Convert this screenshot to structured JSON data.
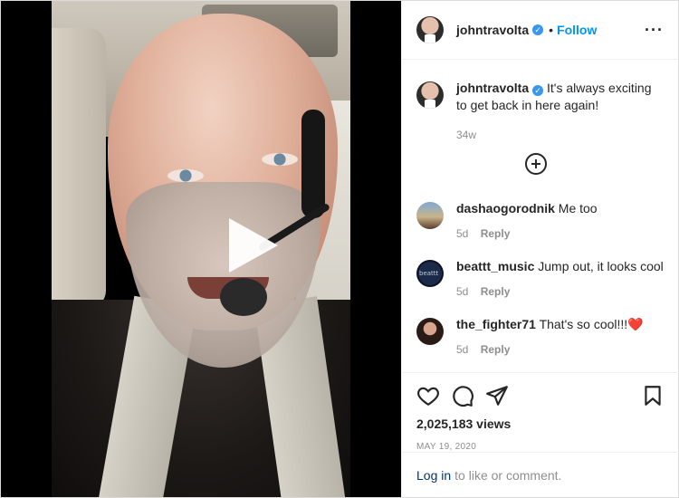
{
  "post": {
    "author": {
      "username": "johntravolta",
      "verified": true,
      "avatar": "travolta-avatar"
    },
    "follow_label": "Follow",
    "separator": "•",
    "more_icon": "more-options-icon",
    "caption": {
      "username": "johntravolta",
      "text": "It's always exciting to get back in here again!",
      "time": "34w"
    },
    "load_more_icon": "plus-circle-icon",
    "comments": [
      {
        "username": "dashaogorodnik",
        "text": "Me too",
        "time": "5d",
        "reply": "Reply"
      },
      {
        "username": "beattt_music",
        "text": "Jump out, it looks cool",
        "time": "5d",
        "reply": "Reply"
      },
      {
        "username": "the_fighter71",
        "text": "That's so cool!!!❤️",
        "time": "5d",
        "reply": "Reply"
      }
    ],
    "actions": {
      "like_icon": "heart-icon",
      "comment_icon": "comment-icon",
      "share_icon": "share-icon",
      "save_icon": "bookmark-icon"
    },
    "views": "2,025,183 views",
    "date": "MAY 19, 2020",
    "login": {
      "link": "Log in",
      "text": "to like or comment."
    },
    "media": {
      "type": "video",
      "play_icon": "play-icon"
    }
  },
  "colors": {
    "accent": "#0095f6",
    "verified": "#3897f0",
    "muted": "#8e8e8e",
    "text": "#262626",
    "link": "#00376b"
  }
}
